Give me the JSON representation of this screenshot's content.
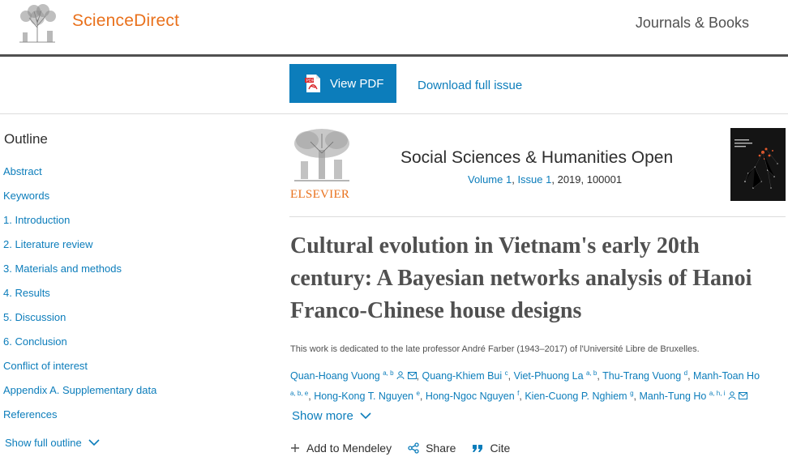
{
  "header": {
    "brand": "ScienceDirect",
    "journals_link": "Journals & Books"
  },
  "toolbar": {
    "view_pdf": "View PDF",
    "download_issue": "Download full issue"
  },
  "outline": {
    "title": "Outline",
    "items": [
      "Abstract",
      "Keywords",
      "1. Introduction",
      "2. Literature review",
      "3. Materials and methods",
      "4. Results",
      "5. Discussion",
      "6. Conclusion",
      "Conflict of interest",
      "Appendix A. Supplementary data",
      "References"
    ],
    "show_full": "Show full outline"
  },
  "journal": {
    "publisher": "ELSEVIER",
    "name": "Social Sciences & Humanities Open",
    "volume": "Volume 1",
    "issue": "Issue 1",
    "meta_rest": ", 2019, 100001"
  },
  "article": {
    "title": "Cultural evolution in Vietnam's early 20th century: A Bayesian networks analysis of Hanoi Franco-Chinese house designs",
    "dedication": "This work is dedicated to the late professor André Farber (1943–2017) of l'Université Libre de Bruxelles.",
    "authors": [
      {
        "name": "Quan-Hoang Vuong",
        "sup": "a, b"
      },
      {
        "name": "Quang-Khiem Bui",
        "sup": "c"
      },
      {
        "name": "Viet-Phuong La",
        "sup": "a, b"
      },
      {
        "name": "Thu-Trang Vuong",
        "sup": "d"
      },
      {
        "name": "Manh-Toan Ho",
        "sup": "a, b, e"
      },
      {
        "name": "Hong-Kong T. Nguyen",
        "sup": "e"
      },
      {
        "name": "Hong-Ngoc Nguyen",
        "sup": "f"
      },
      {
        "name": "Kien-Cuong P. Nghiem",
        "sup": "g"
      },
      {
        "name": "Manh-Tung Ho",
        "sup": "a, h, i"
      }
    ],
    "show_more": "Show more"
  },
  "actions": {
    "mendeley": "Add to Mendeley",
    "share": "Share",
    "cite": "Cite"
  },
  "colors": {
    "brand_orange": "#e9711c",
    "link_blue": "#0c7dbb",
    "text": "#2e2e2e"
  }
}
